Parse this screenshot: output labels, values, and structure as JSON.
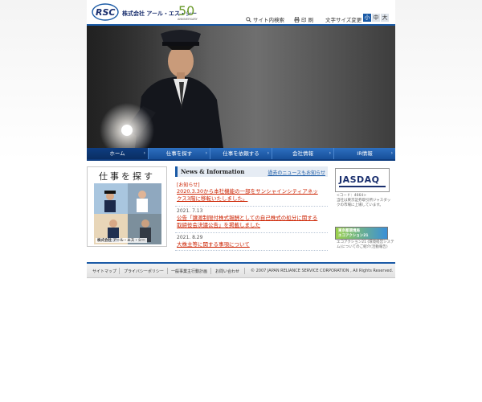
{
  "header": {
    "logo_text": "RSC",
    "company_name": "株式会社 アール・エス・シー",
    "anniversary_number": "50",
    "anniversary_text": "ANNIVERSARY",
    "site_search_label": "サイト内検索",
    "print_label": "印 刷",
    "font_size_label": "文字サイズ変更",
    "font_sizes": [
      "小",
      "中",
      "大"
    ]
  },
  "nav": {
    "items": [
      {
        "label": "ホーム"
      },
      {
        "label": "仕事を探す"
      },
      {
        "label": "仕事を依頼する"
      },
      {
        "label": "会社情報"
      },
      {
        "label": "IR情報"
      }
    ]
  },
  "job_banner": {
    "title": "仕事を探す",
    "caption": "株式会社 アール・エス・シー"
  },
  "news": {
    "title": "News & Information",
    "more_link": "過去のニュースもお知らせ",
    "tag": "[お知らせ]",
    "items": [
      {
        "date": "",
        "text": "2020.3.30から本社機能の一部をサンシャインシティアネックス3階に移転いたしました。"
      },
      {
        "date": "2021. 7.13",
        "text": "公告「譲渡制限付株式報酬としての自己株式の処分に関する取締役会決議公告」を掲載しました"
      },
      {
        "date": "2021. 8.29",
        "text": "大株主等に関する事項について"
      }
    ]
  },
  "sidebar": {
    "jasdaq_label": "JASDAQ",
    "code_text": "<コード：4664>\n当社は東京証券取引所ジャスダックの市場に上場しています。",
    "banner_text": "東京都環境局\nエコアクション21",
    "banner_caption": "エコアクション21 (環境経営システム)についてのご紹介(活動報告)"
  },
  "footer": {
    "links": [
      {
        "label": "サイトマップ"
      },
      {
        "label": "プライバシーポリシー"
      },
      {
        "label": "一般事業主行動計画"
      },
      {
        "label": "お問い合わせ"
      }
    ],
    "copyright": "© 2007 JAPAN RELIANCE SERVICE CORPORATION , All Rights Reserved."
  },
  "colors": {
    "brand_blue": "#1a5aa6",
    "nav_active": "#0e3d80",
    "news_link": "#cc2200"
  }
}
